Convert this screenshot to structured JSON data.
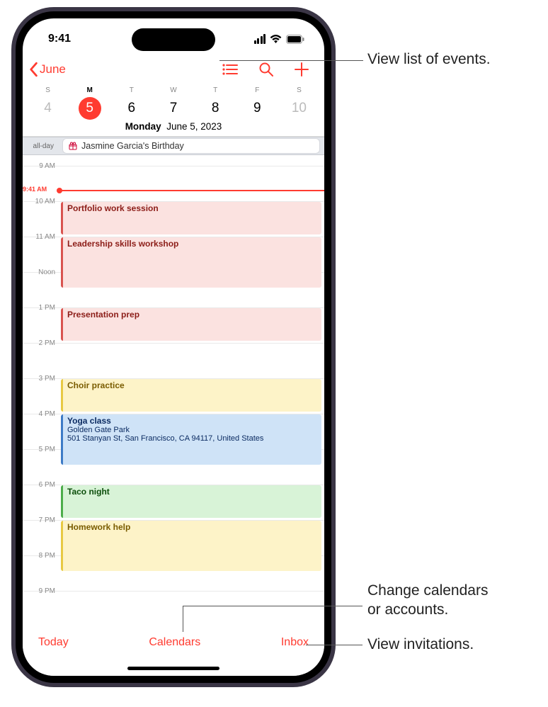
{
  "status": {
    "time": "9:41"
  },
  "header": {
    "back_label": "June"
  },
  "week": {
    "days": [
      {
        "dow": "S",
        "num": "4",
        "dim": true
      },
      {
        "dow": "M",
        "num": "5",
        "selected": true
      },
      {
        "dow": "T",
        "num": "6"
      },
      {
        "dow": "W",
        "num": "7"
      },
      {
        "dow": "T",
        "num": "8"
      },
      {
        "dow": "F",
        "num": "9"
      },
      {
        "dow": "S",
        "num": "10",
        "dim": true
      }
    ],
    "date_dow": "Monday",
    "date_rest": "June 5, 2023"
  },
  "allday": {
    "label": "all-day",
    "event_title": "Jasmine Garcia's Birthday"
  },
  "timeline": {
    "now_label": "9:41 AM",
    "hours": [
      "9 AM",
      "10 AM",
      "11 AM",
      "Noon",
      "1 PM",
      "2 PM",
      "3 PM",
      "4 PM",
      "5 PM",
      "6 PM",
      "7 PM",
      "8 PM",
      "9 PM"
    ],
    "events": [
      {
        "title": "Portfolio work session",
        "color": "red",
        "start_idx": 1,
        "dur": 1
      },
      {
        "title": "Leadership skills workshop",
        "color": "red",
        "start_idx": 2,
        "dur": 1.5
      },
      {
        "title": "Presentation prep",
        "color": "red",
        "start_idx": 4,
        "dur": 1
      },
      {
        "title": "Choir practice",
        "color": "yellow",
        "start_idx": 6,
        "dur": 1
      },
      {
        "title": "Yoga class",
        "loc1": "Golden Gate Park",
        "loc2": "501 Stanyan St, San Francisco, CA 94117, United States",
        "color": "blue",
        "start_idx": 7,
        "dur": 1.5
      },
      {
        "title": "Taco night",
        "color": "green",
        "start_idx": 9,
        "dur": 1
      },
      {
        "title": "Homework help",
        "color": "yellow",
        "start_idx": 10,
        "dur": 1.5
      }
    ]
  },
  "bottombar": {
    "today": "Today",
    "calendars": "Calendars",
    "inbox": "Inbox"
  },
  "callouts": {
    "list_events": "View list of events.",
    "change_cal_1": "Change calendars",
    "change_cal_2": "or accounts.",
    "view_inv": "View invitations."
  }
}
